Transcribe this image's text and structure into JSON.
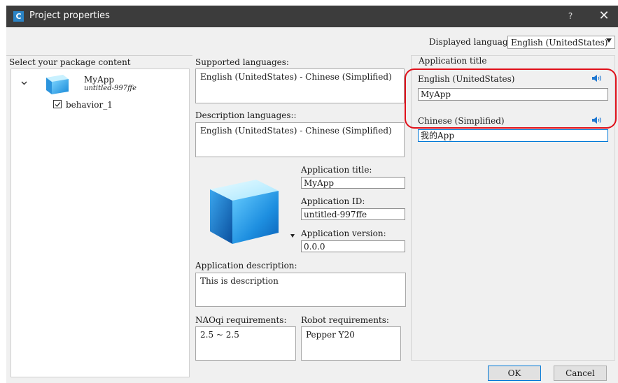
{
  "window": {
    "app_icon_letter": "C",
    "title": "Project properties",
    "help": "?",
    "close": "✕"
  },
  "displayed_language": {
    "label": "Displayed language",
    "value": "English (UnitedStates)"
  },
  "package": {
    "label": "Select your package content",
    "app_name": "MyApp",
    "app_id": "untitled-997ffe",
    "behavior": "behavior_1",
    "behavior_checked": true
  },
  "supported_languages": {
    "label": "Supported languages:",
    "value": "English (UnitedStates) - Chinese (Simplified)"
  },
  "description_languages": {
    "label": "Description languages::",
    "value": "English (UnitedStates) - Chinese (Simplified)"
  },
  "application": {
    "title_label": "Application title:",
    "title_value": "MyApp",
    "id_label": "Application ID:",
    "id_value": "untitled-997ffe",
    "version_label": "Application version:",
    "version_value": "0.0.0",
    "description_label": "Application description:",
    "description_value": "This is description"
  },
  "requirements": {
    "naoqi_label": "NAOqi requirements:",
    "naoqi_value": "2.5 ~ 2.5",
    "robot_label": "Robot requirements:",
    "robot_value": "Pepper Y20"
  },
  "title_group": {
    "label": "Application title",
    "english_label": "English (UnitedStates)",
    "english_value": "MyApp",
    "chinese_label": "Chinese (Simplified)",
    "chinese_value": "我的App",
    "speaker_icon": "speaker-icon",
    "highlight_color": "#e0101a"
  },
  "buttons": {
    "ok": "OK",
    "cancel": "Cancel"
  },
  "colors": {
    "titlebar": "#3c3c3c",
    "accent": "#2b84c6",
    "dialog_bg": "#f0f0f0"
  }
}
